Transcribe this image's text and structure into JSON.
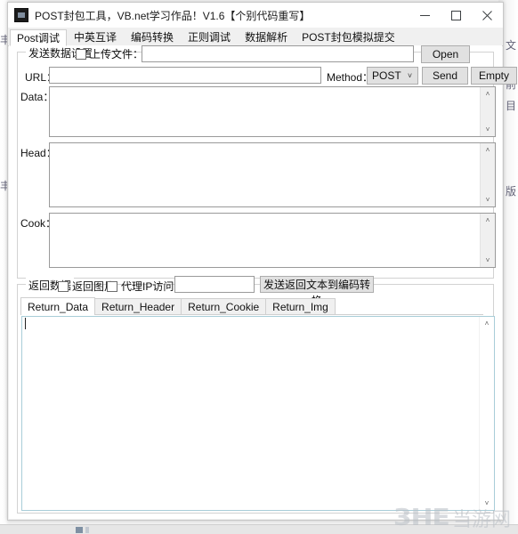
{
  "window": {
    "title": "POST封包工具，VB.net学习作品！V1.6【个别代码重写】",
    "icon": "app-icon",
    "minimize_label": "—",
    "maximize_label": "□",
    "close_label": "✕"
  },
  "main_tabs": [
    {
      "label": "Post调试",
      "active": true
    },
    {
      "label": "中英互译",
      "active": false
    },
    {
      "label": "编码转换",
      "active": false
    },
    {
      "label": "正则调试",
      "active": false
    },
    {
      "label": "数据解析",
      "active": false
    },
    {
      "label": "POST封包模拟提交",
      "active": false
    }
  ],
  "send_group": {
    "legend": "发送数据设置",
    "upload_checkbox": {
      "label": "上传文件：",
      "checked": false
    },
    "upload_path": {
      "value": "",
      "placeholder": ""
    },
    "open_button": "Open",
    "url_label": "URL：",
    "url_value": "",
    "method_label": "Method：",
    "method_value": "POST",
    "method_arrow": "˅",
    "send_button": "Send",
    "empty_button": "Empty",
    "data_label": "Data：",
    "data_value": "",
    "head_label": "Head：",
    "head_value": "",
    "cook_label": "Cook：",
    "cook_value": ""
  },
  "return_group": {
    "legend": "返回数据",
    "return_img_checkbox": {
      "label": "返回图片",
      "checked": false
    },
    "proxy_checkbox": {
      "label": "代理IP访问：",
      "checked": false
    },
    "proxy_value": "",
    "send_to_encode_button": "发送返回文本到编码转换",
    "tabs": [
      {
        "label": "Return_Data",
        "active": true
      },
      {
        "label": "Return_Header",
        "active": false
      },
      {
        "label": "Return_Cookie",
        "active": false
      },
      {
        "label": "Return_Img",
        "active": false
      }
    ],
    "result_value": ""
  },
  "scrollbar": {
    "up_arrow": "˄",
    "down_arrow": "˅"
  },
  "watermark": {
    "logo": "3HE",
    "text": "当游网"
  },
  "background": {
    "right_glyphs": [
      "文",
      "前",
      "目",
      "版"
    ],
    "left_glyphs": [
      "丰",
      "丰"
    ]
  },
  "colors": {
    "window_bg": "#f0f0f0",
    "panel_bg": "#ffffff",
    "border": "#d2d2d2",
    "button_face": "#e1e1e1",
    "focus_border": "#a9cdd8",
    "text": "#111111"
  }
}
